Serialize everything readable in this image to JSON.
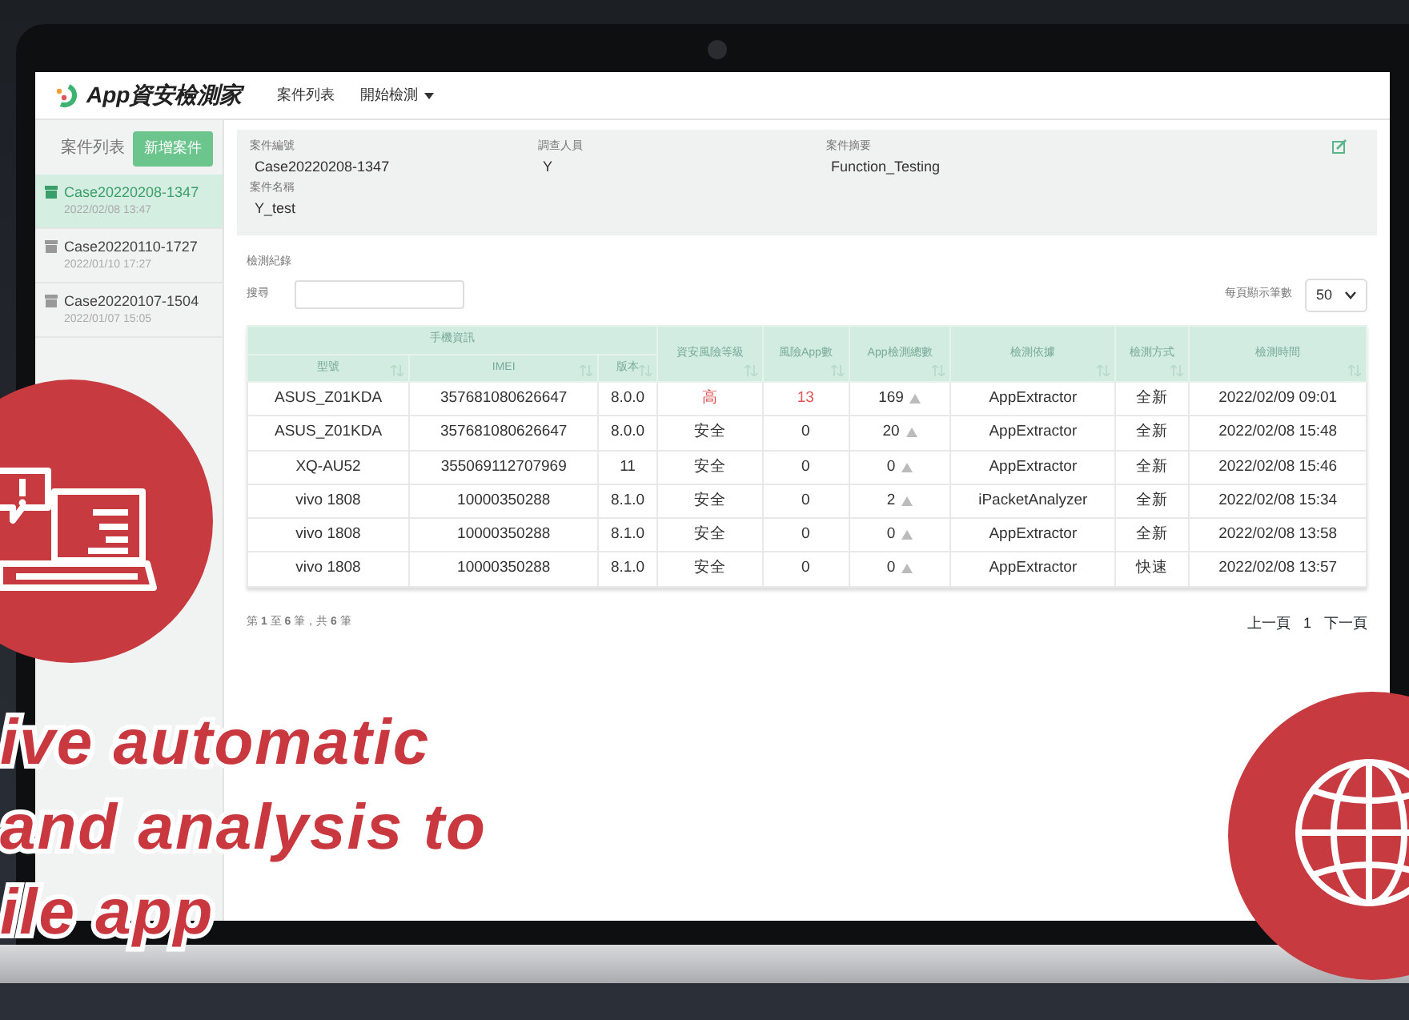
{
  "app": {
    "logo_text": "App資安檢測家",
    "nav": [
      {
        "label": "案件列表",
        "dropdown": false
      },
      {
        "label": "開始檢測",
        "dropdown": true
      }
    ]
  },
  "sidebar": {
    "title": "案件列表",
    "new_button": "新增案件",
    "items": [
      {
        "title": "Case20220208-1347",
        "date": "2022/02/08 13:47",
        "selected": true
      },
      {
        "title": "Case20220110-1727",
        "date": "2022/01/10 17:27",
        "selected": false
      },
      {
        "title": "Case20220107-1504",
        "date": "2022/01/07 15:05",
        "selected": false
      }
    ]
  },
  "case_info": {
    "fields": [
      {
        "label": "案件編號",
        "value": "Case20220208-1347"
      },
      {
        "label": "調查人員",
        "value": "Y"
      },
      {
        "label": "案件摘要",
        "value": "Function_Testing"
      },
      {
        "label": "案件名稱",
        "value": "Y_test"
      }
    ]
  },
  "records": {
    "title": "檢測紀錄",
    "search_label": "搜尋",
    "page_size_label": "每頁顯示筆數",
    "page_size": "50"
  },
  "table": {
    "header_group": "手機資訊",
    "columns": [
      {
        "label": "型號",
        "kind": "device"
      },
      {
        "label": "IMEI",
        "kind": "device"
      },
      {
        "label": "版本",
        "kind": "device"
      },
      {
        "label": "資安風險等級",
        "kind": "risk"
      },
      {
        "label": "風險App數",
        "kind": "risk"
      },
      {
        "label": "App檢測總數",
        "kind": "count"
      },
      {
        "label": "檢測依據",
        "kind": "plain"
      },
      {
        "label": "檢測方式",
        "kind": "plain"
      },
      {
        "label": "檢測時間",
        "kind": "plain"
      }
    ],
    "rows": [
      {
        "risk_high": true,
        "cells": [
          "ASUS_Z01KDA",
          "357681080626647",
          "8.0.0",
          "高",
          "13",
          "169",
          "AppExtractor",
          "全新",
          "2022/02/09 09:01"
        ]
      },
      {
        "risk_high": false,
        "cells": [
          "ASUS_Z01KDA",
          "357681080626647",
          "8.0.0",
          "安全",
          "0",
          "20",
          "AppExtractor",
          "全新",
          "2022/02/08 15:48"
        ]
      },
      {
        "risk_high": false,
        "cells": [
          "XQ-AU52",
          "355069112707969",
          "11",
          "安全",
          "0",
          "0",
          "AppExtractor",
          "全新",
          "2022/02/08 15:46"
        ]
      },
      {
        "risk_high": false,
        "cells": [
          "vivo 1808",
          "10000350288",
          "8.1.0",
          "安全",
          "0",
          "2",
          "iPacketAnalyzer",
          "全新",
          "2022/02/08 15:34"
        ]
      },
      {
        "risk_high": false,
        "cells": [
          "vivo 1808",
          "10000350288",
          "8.1.0",
          "安全",
          "0",
          "0",
          "AppExtractor",
          "全新",
          "2022/02/08 13:58"
        ]
      },
      {
        "risk_high": false,
        "cells": [
          "vivo 1808",
          "10000350288",
          "8.1.0",
          "安全",
          "0",
          "0",
          "AppExtractor",
          "快速",
          "2022/02/08 13:57"
        ]
      }
    ],
    "summary": "第 **1** 至 **6** 筆，共 **6** 筆",
    "pager": {
      "prev": "上一頁",
      "page": "1",
      "next": "下一頁"
    }
  },
  "overlay": {
    "lines": [
      "ive automatic",
      "and analysis to",
      "ile app"
    ]
  }
}
